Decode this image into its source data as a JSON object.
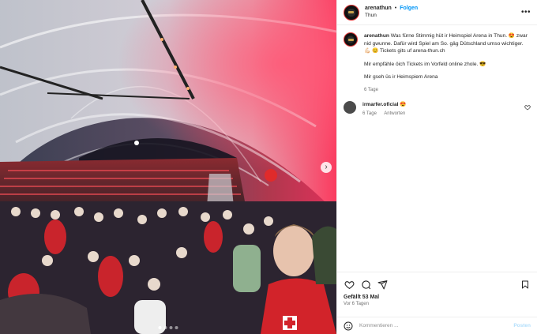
{
  "post": {
    "username": "arenathun",
    "separator": "•",
    "follow_label": "Folgen",
    "location": "Thun",
    "more_icon": "more-horizontal-icon"
  },
  "caption": {
    "username": "arenathun",
    "line1": "Was fürne Stimmig hüt ir Heimspiel Arena in Thun. 😍 zwar nid gwunne. Dafür wird Spiel am So. gäg Dütschland umso wichtiger. 💪🏻 😊 Tickets gits uf arena-thun.ch",
    "line2": "Mir empfähle öich Tickets im Vorfeld online zhole. 😎",
    "line3": "Mir gseh üs ir Heimspiem Arena",
    "time": "6 Tage"
  },
  "reply": {
    "username": "irmarfer.oficial",
    "emoji": "😍",
    "time": "6 Tage",
    "reply_label": "Antworten"
  },
  "actions": {
    "likes": "Gefällt 53 Mal",
    "ago": "Vor 6 Tagen"
  },
  "composer": {
    "placeholder": "Kommentieren ...",
    "post_label": "Posten"
  },
  "media": {
    "next_glyph": "›",
    "slides": 4,
    "active_slide": 1
  },
  "colors": {
    "follow": "#0095f6",
    "post_disabled": "#b2dffc",
    "meta": "#737373",
    "crowd_red": "#d2232a"
  }
}
